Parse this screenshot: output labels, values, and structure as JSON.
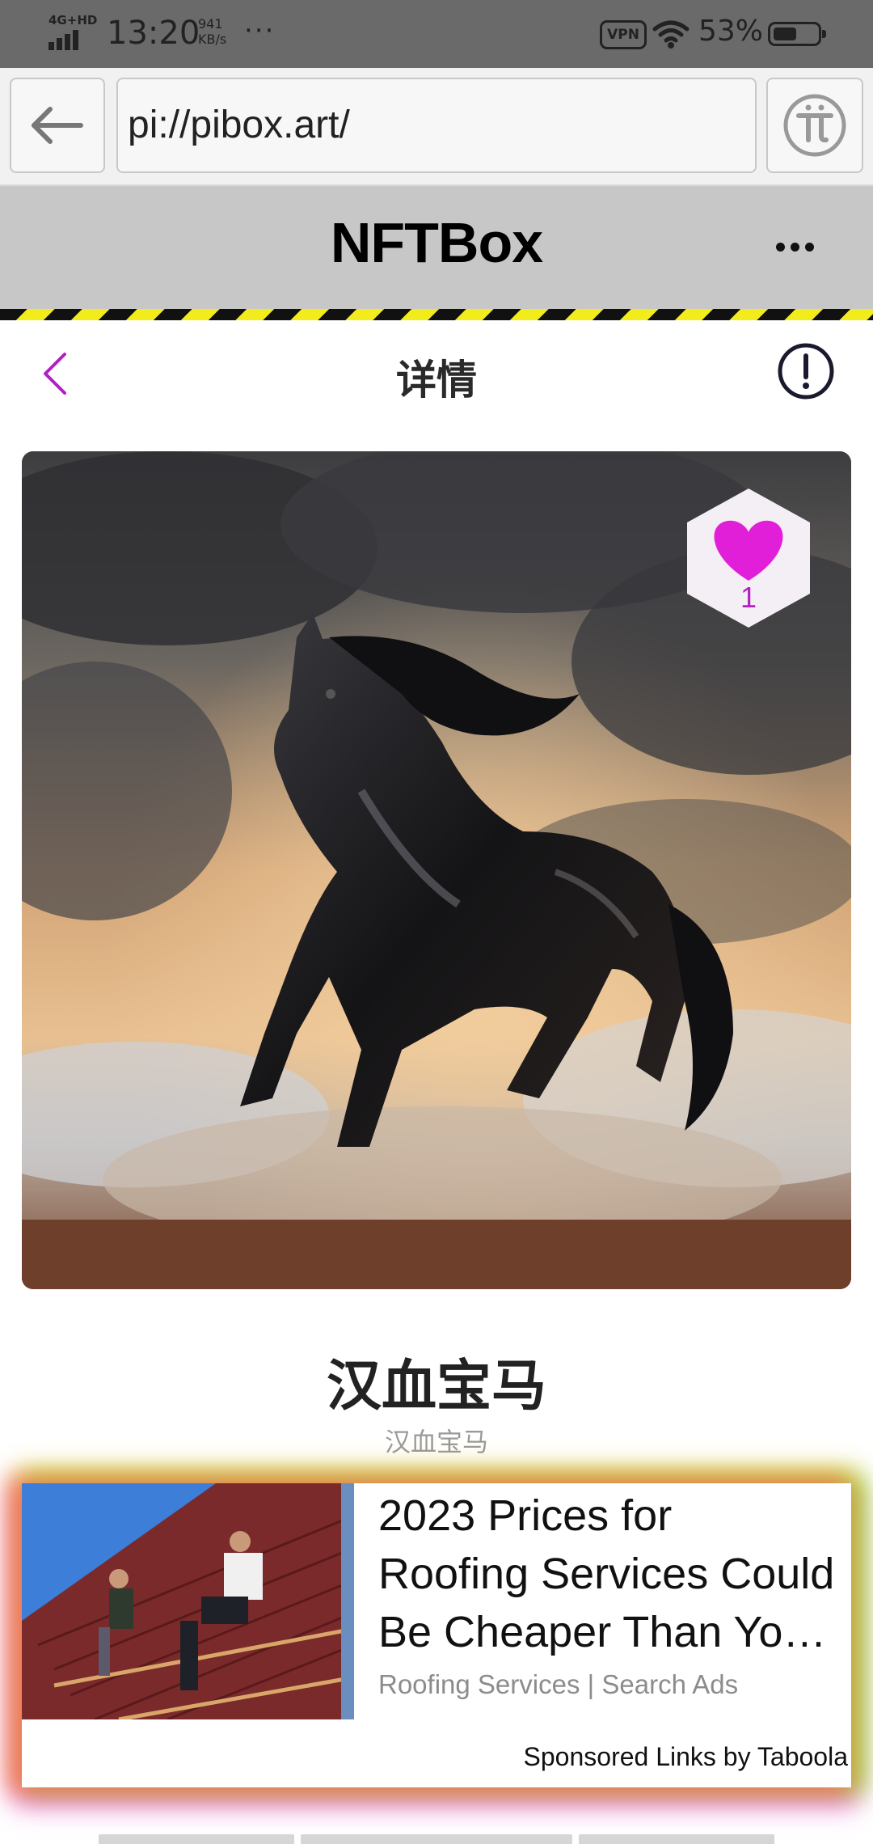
{
  "status_bar": {
    "network": "4G+HD",
    "time": "13:20",
    "speed_value": "941",
    "speed_unit": "KB/s",
    "more": "···",
    "vpn": "VPN",
    "battery_percent": "53%",
    "battery_level": 0.53
  },
  "browser": {
    "url": "pi://pibox.art/",
    "back_icon": "arrow-left-icon",
    "pi_icon": "pi-logo-icon"
  },
  "app_header": {
    "title": "NFTBox",
    "more_icon": "more-horizontal-icon"
  },
  "detail_nav": {
    "title": "详情",
    "back_icon": "chevron-left-icon",
    "report_icon": "exclamation-circle-icon"
  },
  "nft": {
    "image_icon": "black-horse-painting",
    "like_count": "1",
    "title": "汉血宝马",
    "subtitle": "汉血宝马"
  },
  "ad": {
    "headline_lines": [
      "2023 Prices for",
      "Roofing Services Could",
      "Be Cheaper Than Yo…"
    ],
    "source": "Roofing Services | Search Ads",
    "sponsor": "Sponsored Links by Taboola"
  },
  "colors": {
    "accent": "#b21fc2",
    "header_bg": "#c7c7c7",
    "status_bg": "#6a6a6a",
    "stripe_yellow": "#f3ec1c"
  }
}
